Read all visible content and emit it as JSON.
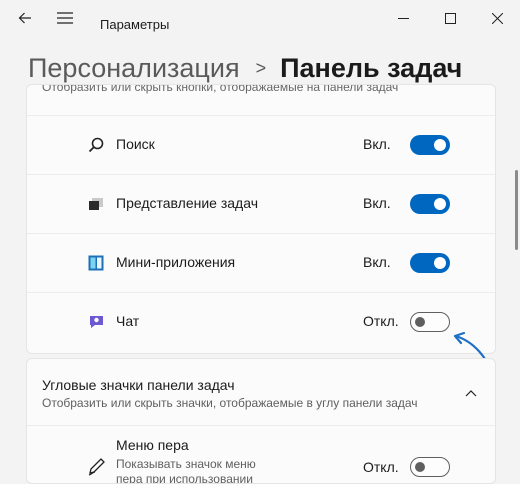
{
  "window": {
    "app_title": "Параметры",
    "back_icon": "back-arrow-icon",
    "menu_icon": "hamburger-menu-icon",
    "controls": [
      "minimize",
      "maximize",
      "close"
    ]
  },
  "header": {
    "parent": "Персонализация",
    "separator": ">",
    "current": "Панель задач"
  },
  "top_section": {
    "cut_text": "Отобразить или скрыть кнопки, отображаемые на панели задач",
    "items": [
      {
        "label": "Поиск",
        "state": "Вкл.",
        "on": true,
        "icon": "search-icon"
      },
      {
        "label": "Представление задач",
        "state": "Вкл.",
        "on": true,
        "icon": "task-view-icon"
      },
      {
        "label": "Мини-приложения",
        "state": "Вкл.",
        "on": true,
        "icon": "widgets-icon"
      },
      {
        "label": "Чат",
        "state": "Откл.",
        "on": false,
        "icon": "chat-icon"
      }
    ]
  },
  "corner_section": {
    "title": "Угловые значки панели задач",
    "subtitle": "Отобразить или скрыть значки, отображаемые в углу панели задач",
    "expanded": true,
    "items": [
      {
        "label": "Меню пера",
        "description": "Показывать значок меню пера при использовании",
        "state": "Откл.",
        "on": false,
        "icon": "pen-icon"
      }
    ]
  },
  "colors": {
    "accent": "#0067c0",
    "annotation_arrow": "#1f6fc5",
    "background": "#f3f3f3",
    "card": "#fbfbfb"
  }
}
